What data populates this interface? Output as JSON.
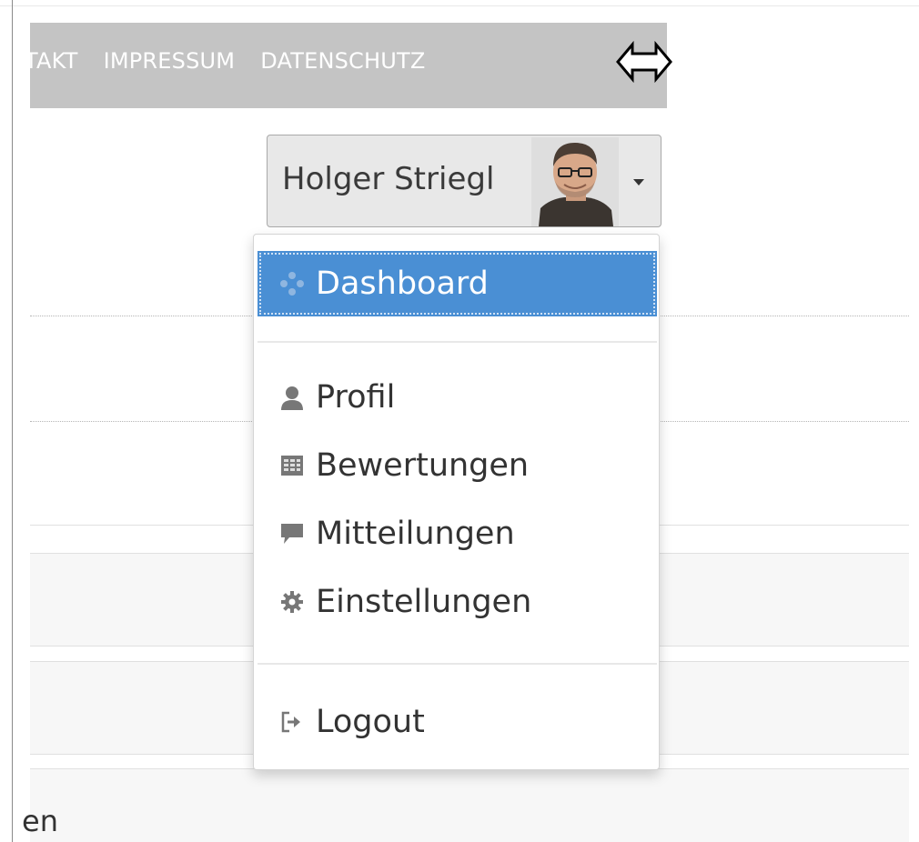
{
  "topnav": {
    "items": [
      "TAKT",
      "IMPRESSUM",
      "DATENSCHUTZ"
    ]
  },
  "user": {
    "name": "Holger Striegl"
  },
  "menu": {
    "items": [
      {
        "label": "Dashboard",
        "icon": "dashboard-icon"
      },
      {
        "label": "Profil",
        "icon": "user-icon"
      },
      {
        "label": "Bewertungen",
        "icon": "table-icon"
      },
      {
        "label": "Mitteilungen",
        "icon": "comment-icon"
      },
      {
        "label": "Einstellungen",
        "icon": "gear-icon"
      },
      {
        "label": "Logout",
        "icon": "logout-icon"
      }
    ]
  },
  "page": {
    "bottom_text": "en"
  },
  "colors": {
    "accent": "#4a8fd4",
    "topbar": "#c4c4c4",
    "text": "#333333"
  }
}
